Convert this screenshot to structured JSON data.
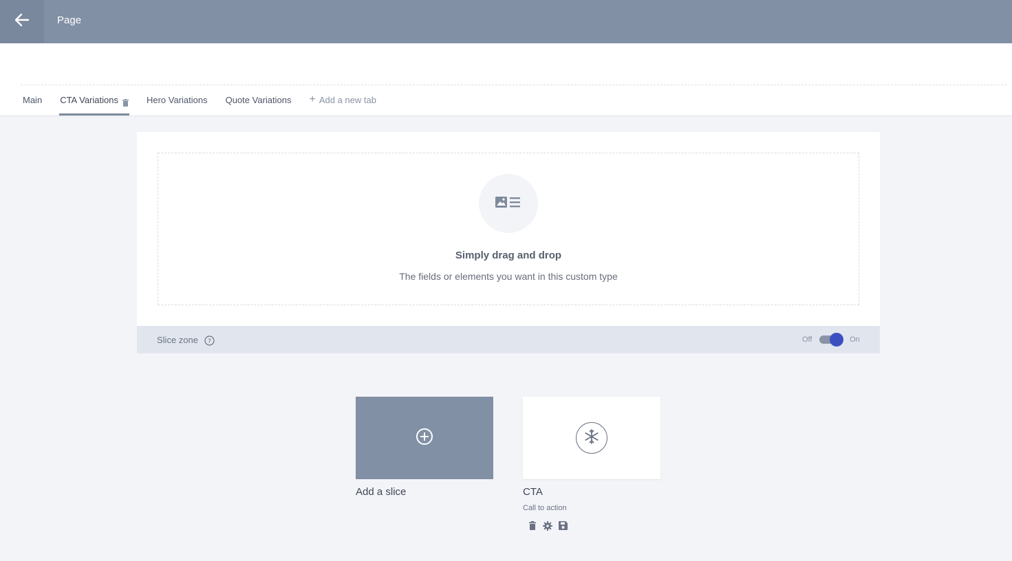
{
  "topbar": {
    "title": "Page"
  },
  "tabs": [
    {
      "label": "Main"
    },
    {
      "label": "CTA Variations"
    },
    {
      "label": "Hero Variations"
    },
    {
      "label": "Quote Variations"
    }
  ],
  "add_tab_label": "Add a new tab",
  "dropzone": {
    "title": "Simply drag and drop",
    "subtitle": "The fields or elements you want in this custom type"
  },
  "slice_zone": {
    "label": "Slice zone",
    "toggle_off": "Off",
    "toggle_on": "On"
  },
  "slices": {
    "add": {
      "label": "Add a slice"
    },
    "cta": {
      "name": "CTA",
      "description": "Call to action"
    }
  }
}
